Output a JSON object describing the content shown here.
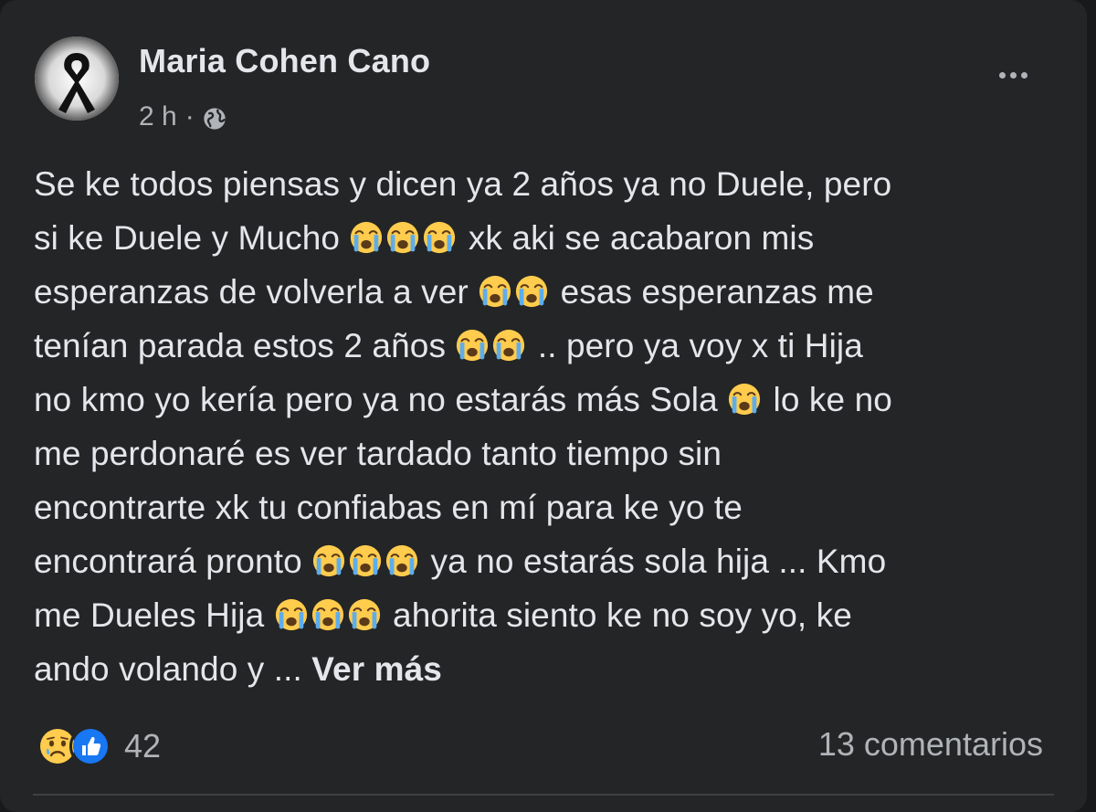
{
  "post": {
    "author": "Maria Cohen Cano",
    "time": "2 h",
    "separator": "·",
    "privacy_icon": "globe-icon",
    "more_icon": "more-options-icon",
    "avatar_icon": "mourning-ribbon-icon",
    "body_lines": [
      [
        {
          "t": "text",
          "v": "Se ke todos piensas y dicen ya 2 años ya no Duele, pero"
        }
      ],
      [
        {
          "t": "text",
          "v": "si ke Duele y Mucho "
        },
        {
          "t": "emoji",
          "n": 3
        },
        {
          "t": "text",
          "v": "  xk aki se acabaron mis"
        }
      ],
      [
        {
          "t": "text",
          "v": "esperanzas de volverla a ver "
        },
        {
          "t": "emoji",
          "n": 2
        },
        {
          "t": "text",
          "v": " esas esperanzas me"
        }
      ],
      [
        {
          "t": "text",
          "v": "tenían parada estos 2 años "
        },
        {
          "t": "emoji",
          "n": 2
        },
        {
          "t": "text",
          "v": "  .. pero ya voy x ti Hija"
        }
      ],
      [
        {
          "t": "text",
          "v": "no kmo yo kería pero ya no estarás más Sola "
        },
        {
          "t": "emoji",
          "n": 1
        },
        {
          "t": "text",
          "v": " lo ke no"
        }
      ],
      [
        {
          "t": "text",
          "v": "me perdonaré es ver tardado tanto tiempo sin"
        }
      ],
      [
        {
          "t": "text",
          "v": "encontrarte xk tu confiabas  en mí para ke yo te"
        }
      ],
      [
        {
          "t": "text",
          "v": "encontrará pronto "
        },
        {
          "t": "emoji",
          "n": 3
        },
        {
          "t": "text",
          "v": " ya no estarás sola hija ... Kmo"
        }
      ],
      [
        {
          "t": "text",
          "v": "me Dueles Hija "
        },
        {
          "t": "emoji",
          "n": 3
        },
        {
          "t": "text",
          "v": " ahorita siento ke no soy yo, ke"
        }
      ],
      [
        {
          "t": "text",
          "v": "ando volando y ... "
        },
        {
          "t": "more",
          "v": "Ver más"
        }
      ]
    ],
    "emoji_name": "loudly-crying-face-emoji"
  },
  "footer": {
    "reactions": [
      "sad-reaction-icon",
      "like-reaction-icon"
    ],
    "reaction_count": "42",
    "comments": "13 comentarios"
  },
  "colors": {
    "card_bg": "#242526",
    "text": "#e4e6eb",
    "secondary": "#b0b3b8",
    "like_blue": "#1877f2",
    "emoji_yellow": "#ffcc4d",
    "tear_blue": "#5dadec"
  }
}
